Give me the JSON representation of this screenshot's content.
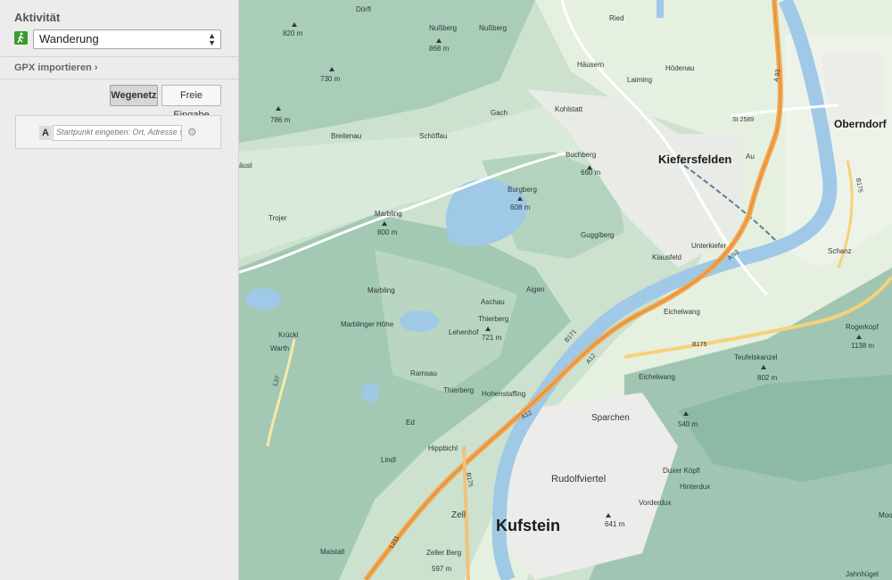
{
  "sidebar": {
    "activity_title": "Aktivität",
    "activity_icon": "hiker-icon",
    "activity_value": "Wanderung",
    "gpx_import": "GPX importieren",
    "buttons": {
      "route_network": "Wegenetz",
      "free_input": "Freie Eingabe"
    },
    "start_point": {
      "letter": "A",
      "placeholder": "Startpunkt eingeben: Ort, Adresse suchen"
    }
  },
  "colors": {
    "motorway": "#f2a74f",
    "river": "#9fc9e6",
    "forest": "#9ec9b2",
    "meadow": "#dcecd7"
  },
  "map": {
    "places": {
      "kufstein": "Kufstein",
      "kiefersfelden": "Kiefersfelden",
      "oberndorf": "Oberndorf",
      "sparchen": "Sparchen",
      "rudolfviertel": "Rudolfviertel",
      "zell": "Zell",
      "eichelwang1": "Eichelwang",
      "eichelwang2": "Eichelwang",
      "unterkiefer": "Unterkiefer",
      "klausfeld": "Klausfeld",
      "kohlstatt": "Kohlstatt",
      "laiming": "Laiming",
      "hausern": "Häusern",
      "hodenau": "Hödenau",
      "ried": "Ried",
      "dorfl": "Dörfl",
      "nussberg1": "Nußberg",
      "nussberg2": "Nußberg",
      "breitenau": "Breitenau",
      "schoffau": "Schöffau",
      "gach": "Gach",
      "trojer": "Trojer",
      "marbling1": "Marbling",
      "marbling2": "Marbling",
      "marblinger_hohe": "Marblinger Höhe",
      "kruckl": "Krückl",
      "warth": "Warth",
      "ramsau": "Ramsau",
      "thierberg1": "Thierberg",
      "thierberg2": "Thierberg",
      "lehenhof": "Lehenhof",
      "aschau": "Aschau",
      "aigen": "Aigen",
      "hohenstaffing": "Hohenstaffing",
      "hippbichl": "Hippbichl",
      "lindl": "Lindl",
      "ed": "Ed",
      "maistall": "Maistall",
      "zeller_berg": "Zeller Berg",
      "buchberg": "Buchberg",
      "burgberg": "Burgberg",
      "guggiberg": "Guggiberg",
      "teufelskanzel": "Teufelskanzel",
      "rogerkopf": "Rogerkopf",
      "duxer_kopfl": "Duxer Köpfl",
      "hinterdux": "Hinterdux",
      "vorderdux": "Vorderdux",
      "jahnhugel": "Jahnhügel",
      "schanz": "Schanz",
      "ausl": "äusl",
      "au": "Au",
      "moo": "Moos"
    },
    "elevations": {
      "e820": "820 m",
      "e868": "868 m",
      "e730": "730 m",
      "e786": "786 m",
      "e660": "660 m",
      "e608": "608 m",
      "e800": "800 m",
      "e721": "721 m",
      "e1138": "1138 m",
      "e802": "802 m",
      "e540": "540 m",
      "e641": "641 m",
      "e597": "597 m"
    },
    "roads": {
      "a93a": "A 93",
      "a93b": "A 93",
      "st2589": "St 2589",
      "b175a": "B175",
      "b175b": "B175",
      "b171": "B171",
      "a12a": "A12",
      "a12b": "A12",
      "l37": "L37",
      "l211": "L211",
      "b175c": "B175"
    }
  }
}
